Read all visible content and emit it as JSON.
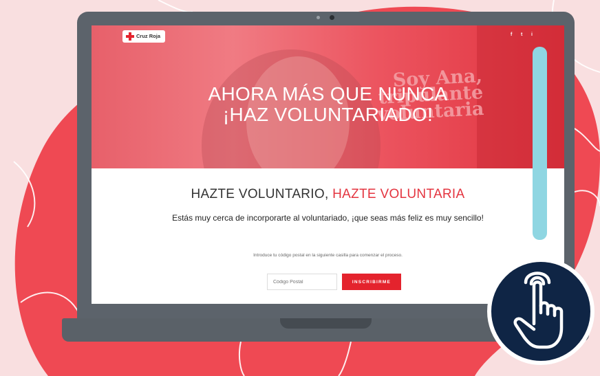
{
  "brand": {
    "name": "Cruz Roja"
  },
  "social": [
    "f",
    "t",
    "i"
  ],
  "hero": {
    "title_line1": "AHORA MÁS QUE NUNCA",
    "title_line2": "¡HAZ VOLUNTARIADO!",
    "tagline": [
      "Soy Ana,",
      "tripulante",
      "voluntaria"
    ]
  },
  "section": {
    "heading_part1": "HAZTE VOLUNTARIO, ",
    "heading_part2": "HAZTE VOLUNTARIA",
    "lead": "Estás muy cerca de incorporarte al voluntariado, ¡que seas más feliz es muy sencillo!",
    "hint": "Introduce tu código postal en la siguiente casilla para comenzar el proceso."
  },
  "form": {
    "postal_placeholder": "Código Postal",
    "postal_value": "",
    "submit_label": "INSCRIBIRME"
  },
  "colors": {
    "brand_red": "#e4232d",
    "heading_red": "#e4343f",
    "navy": "#0f2545",
    "scroll_accent": "#8fd6e2"
  },
  "icons": [
    "facebook-icon",
    "twitter-icon",
    "instagram-icon",
    "hand-pointer-icon",
    "red-cross-icon"
  ]
}
